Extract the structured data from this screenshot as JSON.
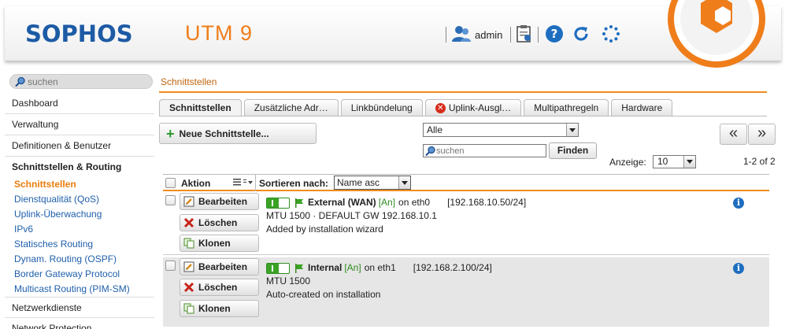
{
  "header": {
    "brand": "SOPHOS",
    "product": "UTM 9",
    "user": "admin"
  },
  "search": {
    "placeholder": "suchen"
  },
  "breadcrumb": "Schnittstellen",
  "sidebar": {
    "items_top": [
      "Dashboard",
      "Verwaltung",
      "Definitionen & Benutzer"
    ],
    "active_section": "Schnittstellen & Routing",
    "sub_items": [
      "Schnittstellen",
      "Dienstqualität (QoS)",
      "Uplink-Überwachung",
      "IPv6",
      "Statisches Routing",
      "Dynam. Routing (OSPF)",
      "Border Gateway Protocol",
      "Multicast Routing (PIM-SM)"
    ],
    "items_bottom": [
      "Netzwerkdienste",
      "Network Protection"
    ]
  },
  "tabs": [
    "Schnittstellen",
    "Zusätzliche Adr…",
    "Linkbündelung",
    "Uplink-Ausgl…",
    "Multipathregeln",
    "Hardware"
  ],
  "toolbar": {
    "new_label": "Neue Schnittstelle...",
    "filter_value": "Alle",
    "search_placeholder": "suchen",
    "find_label": "Finden",
    "prev": "«",
    "next": "»",
    "show_label": "Anzeige:",
    "show_value": "10",
    "count": "1-2 of 2"
  },
  "table": {
    "action_header": "Aktion",
    "sort_label": "Sortieren nach:",
    "sort_value": "Name asc",
    "buttons": {
      "edit": "Bearbeiten",
      "delete": "Löschen",
      "clone": "Klonen"
    },
    "rows": [
      {
        "name": "External (WAN)",
        "state": "[An]",
        "iface": "on eth0",
        "ip": "[192.168.10.50/24]",
        "line2": "MTU 1500 · DEFAULT GW 192.168.10.1",
        "line3": "Added by installation wizard"
      },
      {
        "name": "Internal",
        "state": "[An]",
        "iface": "on eth1",
        "ip": "[192.168.2.100/24]",
        "line2": "MTU 1500",
        "line3": "Auto-created on installation"
      }
    ]
  },
  "colors": {
    "brand_blue": "#1d5ba5",
    "accent_orange": "#ef7d1a",
    "link_blue": "#1f5fab",
    "active_green": "#3aa326"
  }
}
